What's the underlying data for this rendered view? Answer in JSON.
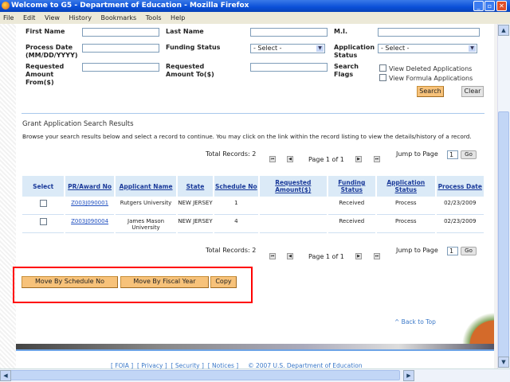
{
  "window": {
    "title": "Welcome to G5 - Department of Education - Mozilla Firefox"
  },
  "menu": [
    "File",
    "Edit",
    "View",
    "History",
    "Bookmarks",
    "Tools",
    "Help"
  ],
  "form": {
    "first_name": "First Name",
    "last_name": "Last Name",
    "mi": "M.I.",
    "process_date": "Process Date (MM/DD/YYYY)",
    "funding_status": "Funding Status",
    "funding_select": "- Select -",
    "application_status": "Application Status",
    "application_select": "- Select -",
    "req_from": "Requested Amount From($)",
    "req_to": "Requested Amount To($)",
    "search_flags": "Search Flags",
    "view_deleted": "View Deleted Applications",
    "view_formula": "View Formula Applications",
    "search": "Search",
    "clear": "Clear"
  },
  "results": {
    "heading": "Grant Application Search Results",
    "instructions": "Browse your search results below and select a record to continue. You may click on the link within the record listing to view the details/history of a record.",
    "total": "Total Records: 2",
    "page": "Page 1 of 1",
    "jump": "Jump to Page",
    "jump_value": "1",
    "go": "Go",
    "columns": [
      "Select",
      "PR/Award No",
      "Applicant Name",
      "State",
      "Schedule No",
      "Requested Amount($)",
      "Funding Status",
      "Application Status",
      "Process Date"
    ],
    "rows": [
      {
        "award": "Z003J090001",
        "applicant": "Rutgers University",
        "state": "NEW JERSEY",
        "schedule": "1",
        "amount": "",
        "funding": "Received",
        "status": "Process",
        "date": "02/23/2009"
      },
      {
        "award": "Z003J090004",
        "applicant": "James Mason University",
        "state": "NEW JERSEY",
        "schedule": "4",
        "amount": "",
        "funding": "Received",
        "status": "Process",
        "date": "02/23/2009"
      }
    ]
  },
  "actions": {
    "move_schedule": "Move By Schedule No",
    "move_fiscal": "Move By Fiscal Year",
    "copy": "Copy"
  },
  "back_to_top": "^ Back to Top",
  "footer": {
    "links": [
      "FOIA",
      "Privacy",
      "Security",
      "Notices"
    ],
    "copyright": "© 2007 U.S. Department of Education"
  },
  "colors": {
    "accent_button": "#f7c27a",
    "header_bg": "#dbeaf7",
    "link": "#2050c0",
    "highlight_box": "#ff0000"
  }
}
